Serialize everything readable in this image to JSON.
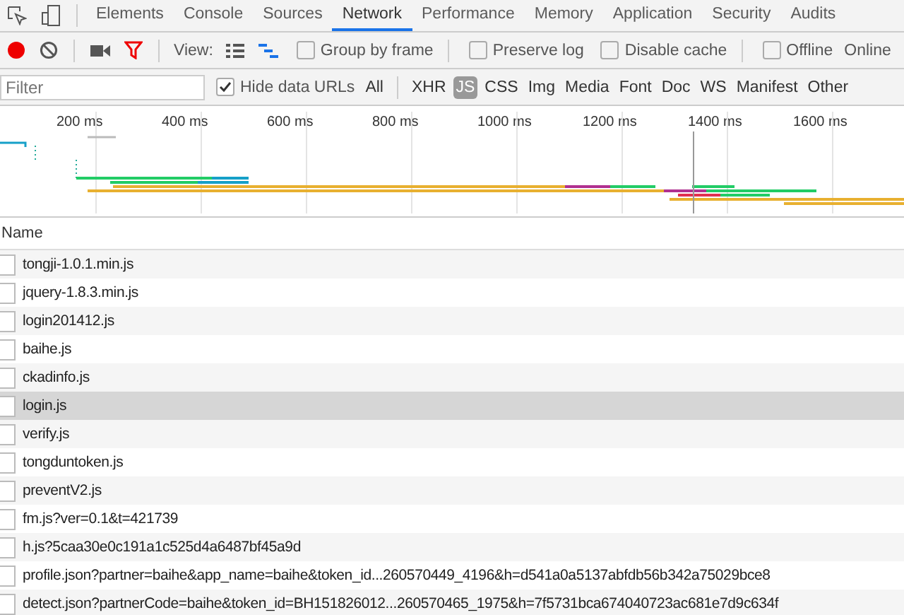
{
  "tabs": [
    {
      "label": "Elements",
      "selected": false
    },
    {
      "label": "Console",
      "selected": false
    },
    {
      "label": "Sources",
      "selected": false
    },
    {
      "label": "Network",
      "selected": true
    },
    {
      "label": "Performance",
      "selected": false
    },
    {
      "label": "Memory",
      "selected": false
    },
    {
      "label": "Application",
      "selected": false
    },
    {
      "label": "Security",
      "selected": false
    },
    {
      "label": "Audits",
      "selected": false
    }
  ],
  "toolbar": {
    "recording": true,
    "view_label": "View:",
    "options": [
      {
        "label": "Group by frame",
        "checked": false
      },
      {
        "label": "Preserve log",
        "checked": false
      },
      {
        "label": "Disable cache",
        "checked": false
      },
      {
        "label": "Offline",
        "checked": false
      }
    ],
    "throttle": "Online"
  },
  "filter_bar": {
    "placeholder": "Filter",
    "hide_data_urls": {
      "label": "Hide data URLs",
      "checked": true
    },
    "types": [
      {
        "label": "All",
        "selected": false
      },
      {
        "label": "XHR",
        "selected": false
      },
      {
        "label": "JS",
        "selected": true
      },
      {
        "label": "CSS",
        "selected": false
      },
      {
        "label": "Img",
        "selected": false
      },
      {
        "label": "Media",
        "selected": false
      },
      {
        "label": "Font",
        "selected": false
      },
      {
        "label": "Doc",
        "selected": false
      },
      {
        "label": "WS",
        "selected": false
      },
      {
        "label": "Manifest",
        "selected": false
      },
      {
        "label": "Other",
        "selected": false
      }
    ]
  },
  "timeline": {
    "ticks": [
      "200 ms",
      "400 ms",
      "600 ms",
      "800 ms",
      "1000 ms",
      "1200 ms",
      "1400 ms",
      "1600 ms"
    ]
  },
  "table": {
    "column": "Name",
    "rows": [
      {
        "name": "tongji-1.0.1.min.js",
        "selected": false
      },
      {
        "name": "jquery-1.8.3.min.js",
        "selected": false
      },
      {
        "name": "login201412.js",
        "selected": false
      },
      {
        "name": "baihe.js",
        "selected": false
      },
      {
        "name": "ckadinfo.js",
        "selected": false
      },
      {
        "name": "login.js",
        "selected": true
      },
      {
        "name": "verify.js",
        "selected": false
      },
      {
        "name": "tongduntoken.js",
        "selected": false
      },
      {
        "name": "preventV2.js",
        "selected": false
      },
      {
        "name": "fm.js?ver=0.1&t=421739",
        "selected": false
      },
      {
        "name": "h.js?5caa30e0c191a1c525d4a6487bf45a9d",
        "selected": false
      },
      {
        "name": "profile.json?partner=baihe&app_name=baihe&token_id...260570449_4196&h=d541a0a5137abfdb56b342a75029bce8",
        "selected": false
      },
      {
        "name": "detect.json?partnerCode=baihe&token_id=BH151826012...260570465_1975&h=7f5731bca674040723ac681e7d9c634f",
        "selected": false
      }
    ]
  }
}
